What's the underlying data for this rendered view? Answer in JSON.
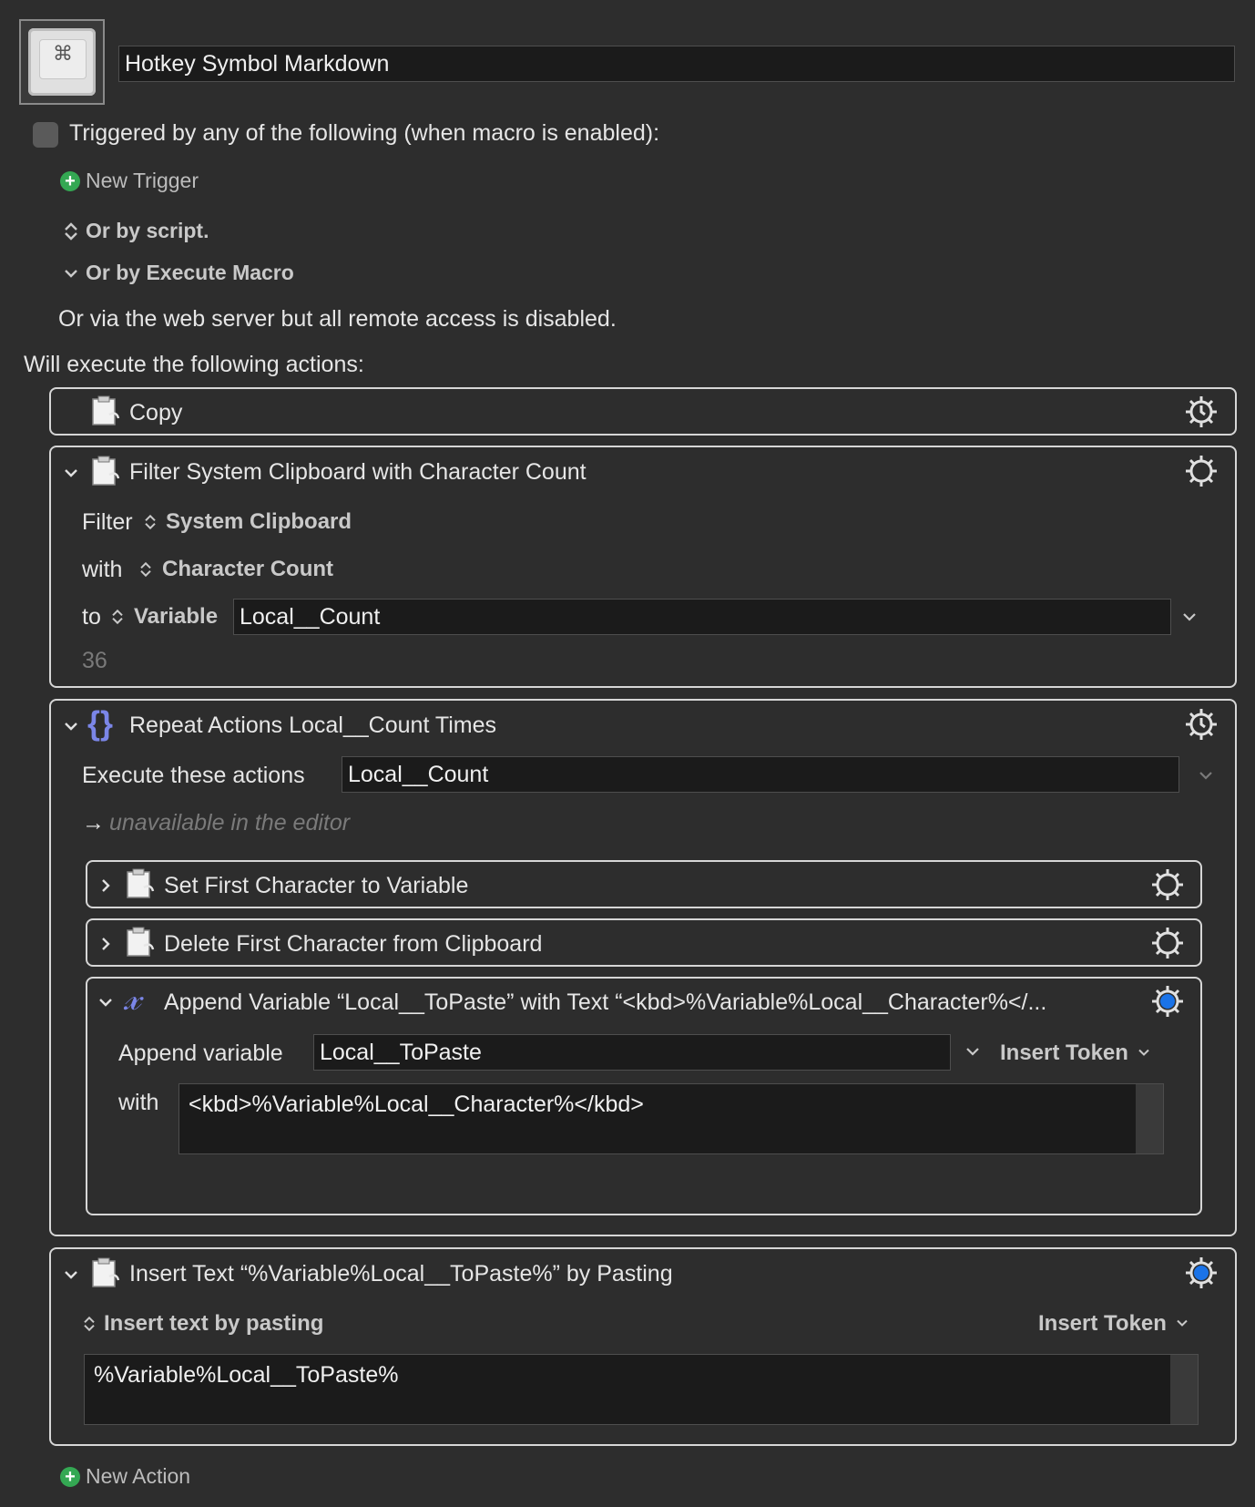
{
  "macro": {
    "name": "Hotkey Symbol Markdown",
    "icon_glyph": "⌘",
    "icon_name": "keyboard-key-icon"
  },
  "trigger": {
    "header": "Triggered by any of the following (when macro is enabled):",
    "new_trigger": "New Trigger",
    "or_by_script": "Or by script.",
    "or_by_execute_macro": "Or by Execute Macro",
    "web_server": "Or via the web server but all remote access is disabled."
  },
  "actions_header": "Will execute the following actions:",
  "actions": {
    "copy": {
      "title": "Copy"
    },
    "filter": {
      "title": "Filter System Clipboard with Character Count",
      "filter_label": "Filter",
      "filter_value": "System Clipboard",
      "with_label": "with",
      "with_value": "Character Count",
      "to_label": "to",
      "to_value": "Variable",
      "variable": "Local__Count",
      "preview": "36"
    },
    "repeat": {
      "title": "Repeat Actions Local__Count Times",
      "execute_label": "Execute these actions",
      "execute_value": "Local__Count",
      "unavailable": "unavailable in the editor",
      "set_first": {
        "title": "Set First Character to Variable"
      },
      "delete_first": {
        "title": "Delete First Character from Clipboard"
      },
      "append": {
        "title": "Append Variable “Local__ToPaste” with Text “<kbd>%Variable%Local__Character%</...",
        "append_label": "Append variable",
        "variable": "Local__ToPaste",
        "insert_token": "Insert Token",
        "with_label": "with",
        "text": "<kbd>%Variable%Local__Character%</kbd>"
      }
    },
    "insert": {
      "title": "Insert Text “%Variable%Local__ToPaste%” by Pasting",
      "mode": "Insert text by pasting",
      "insert_token": "Insert Token",
      "text": "%Variable%Local__ToPaste%"
    }
  },
  "new_action": "New Action",
  "colors": {
    "background": "#2d2d2d",
    "field": "#1b1b1b",
    "accent_green": "#34a853",
    "accent_blue": "#1a73e8",
    "repeat_icon": "#7b86e8"
  }
}
